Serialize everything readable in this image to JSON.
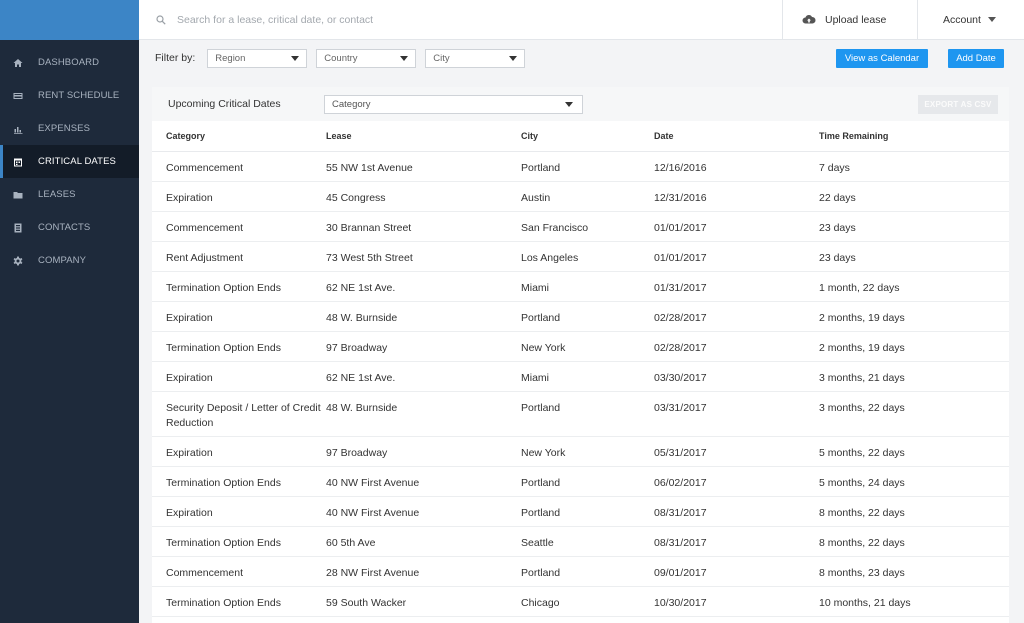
{
  "search": {
    "placeholder": "Search for a lease, critical date, or contact"
  },
  "header": {
    "upload_label": "Upload lease",
    "account_label": "Account"
  },
  "sidebar": {
    "items": [
      {
        "label": "DASHBOARD",
        "icon": "home-icon"
      },
      {
        "label": "RENT SCHEDULE",
        "icon": "card-icon"
      },
      {
        "label": "EXPENSES",
        "icon": "bar-chart-icon"
      },
      {
        "label": "CRITICAL DATES",
        "icon": "calendar-icon",
        "active": true
      },
      {
        "label": "LEASES",
        "icon": "folder-icon"
      },
      {
        "label": "CONTACTS",
        "icon": "contact-book-icon"
      },
      {
        "label": "COMPANY",
        "icon": "gear-icon"
      }
    ]
  },
  "filters": {
    "label": "Filter by:",
    "region": "Region",
    "country": "Country",
    "city": "City",
    "calendar_button": "View as Calendar",
    "add_button": "Add Date"
  },
  "card": {
    "title": "Upcoming Critical Dates",
    "category_select": "Category",
    "export_button": "EXPORT AS CSV"
  },
  "table": {
    "headers": [
      "Category",
      "Lease",
      "City",
      "Date",
      "Time Remaining"
    ],
    "rows": [
      [
        "Commencement",
        "55 NW 1st Avenue",
        "Portland",
        "12/16/2016",
        "7 days"
      ],
      [
        "Expiration",
        "45 Congress",
        "Austin",
        "12/31/2016",
        "22 days"
      ],
      [
        "Commencement",
        "30 Brannan Street",
        "San Francisco",
        "01/01/2017",
        "23 days"
      ],
      [
        "Rent Adjustment",
        "73 West 5th Street",
        "Los Angeles",
        "01/01/2017",
        "23 days"
      ],
      [
        "Termination Option Ends",
        "62 NE 1st Ave.",
        "Miami",
        "01/31/2017",
        "1 month, 22 days"
      ],
      [
        "Expiration",
        "48 W. Burnside",
        "Portland",
        "02/28/2017",
        "2 months, 19 days"
      ],
      [
        "Termination Option Ends",
        "97 Broadway",
        "New York",
        "02/28/2017",
        "2 months, 19 days"
      ],
      [
        "Expiration",
        "62 NE 1st Ave.",
        "Miami",
        "03/30/2017",
        "3 months, 21 days"
      ],
      [
        "Security Deposit / Letter of Credit Reduction",
        "48 W. Burnside",
        "Portland",
        "03/31/2017",
        "3 months, 22 days"
      ],
      [
        "Expiration",
        "97 Broadway",
        "New York",
        "05/31/2017",
        "5 months, 22 days"
      ],
      [
        "Termination Option Ends",
        "40 NW First Avenue",
        "Portland",
        "06/02/2017",
        "5 months, 24 days"
      ],
      [
        "Expiration",
        "40 NW First Avenue",
        "Portland",
        "08/31/2017",
        "8 months, 22 days"
      ],
      [
        "Termination Option Ends",
        "60 5th Ave",
        "Seattle",
        "08/31/2017",
        "8 months, 22 days"
      ],
      [
        "Commencement",
        "28 NW First Avenue",
        "Portland",
        "09/01/2017",
        "8 months, 23 days"
      ],
      [
        "Termination Option Ends",
        "59 South Wacker",
        "Chicago",
        "10/30/2017",
        "10 months, 21 days"
      ]
    ]
  },
  "colors": {
    "sidebar": "#1e2a3b",
    "accent": "#3c85c6",
    "button": "#1e96f0"
  }
}
